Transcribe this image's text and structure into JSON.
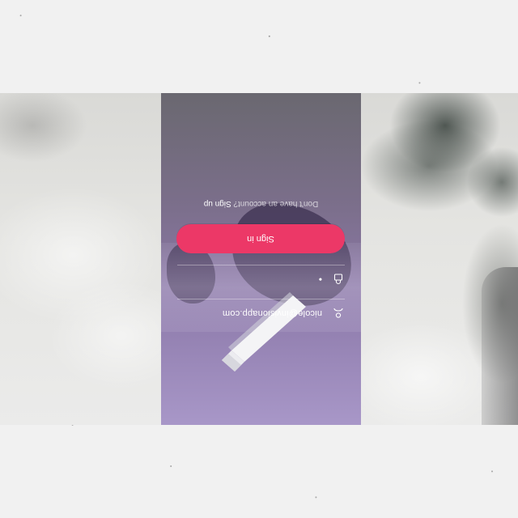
{
  "login": {
    "email_value": "nicole@invisionapp.com",
    "password_value": "•",
    "signin_label": "Sign in",
    "no_account_text": "Don't have an account? ",
    "signup_label": "Sign up"
  },
  "icons": {
    "email": "user-icon",
    "password": "lock-icon",
    "logo": "chevron-logo"
  },
  "colors": {
    "accent": "#ec3867",
    "gradient_top": "#a897c8",
    "gradient_bottom": "#6a6870",
    "page_bg": "#f1f1f1"
  }
}
